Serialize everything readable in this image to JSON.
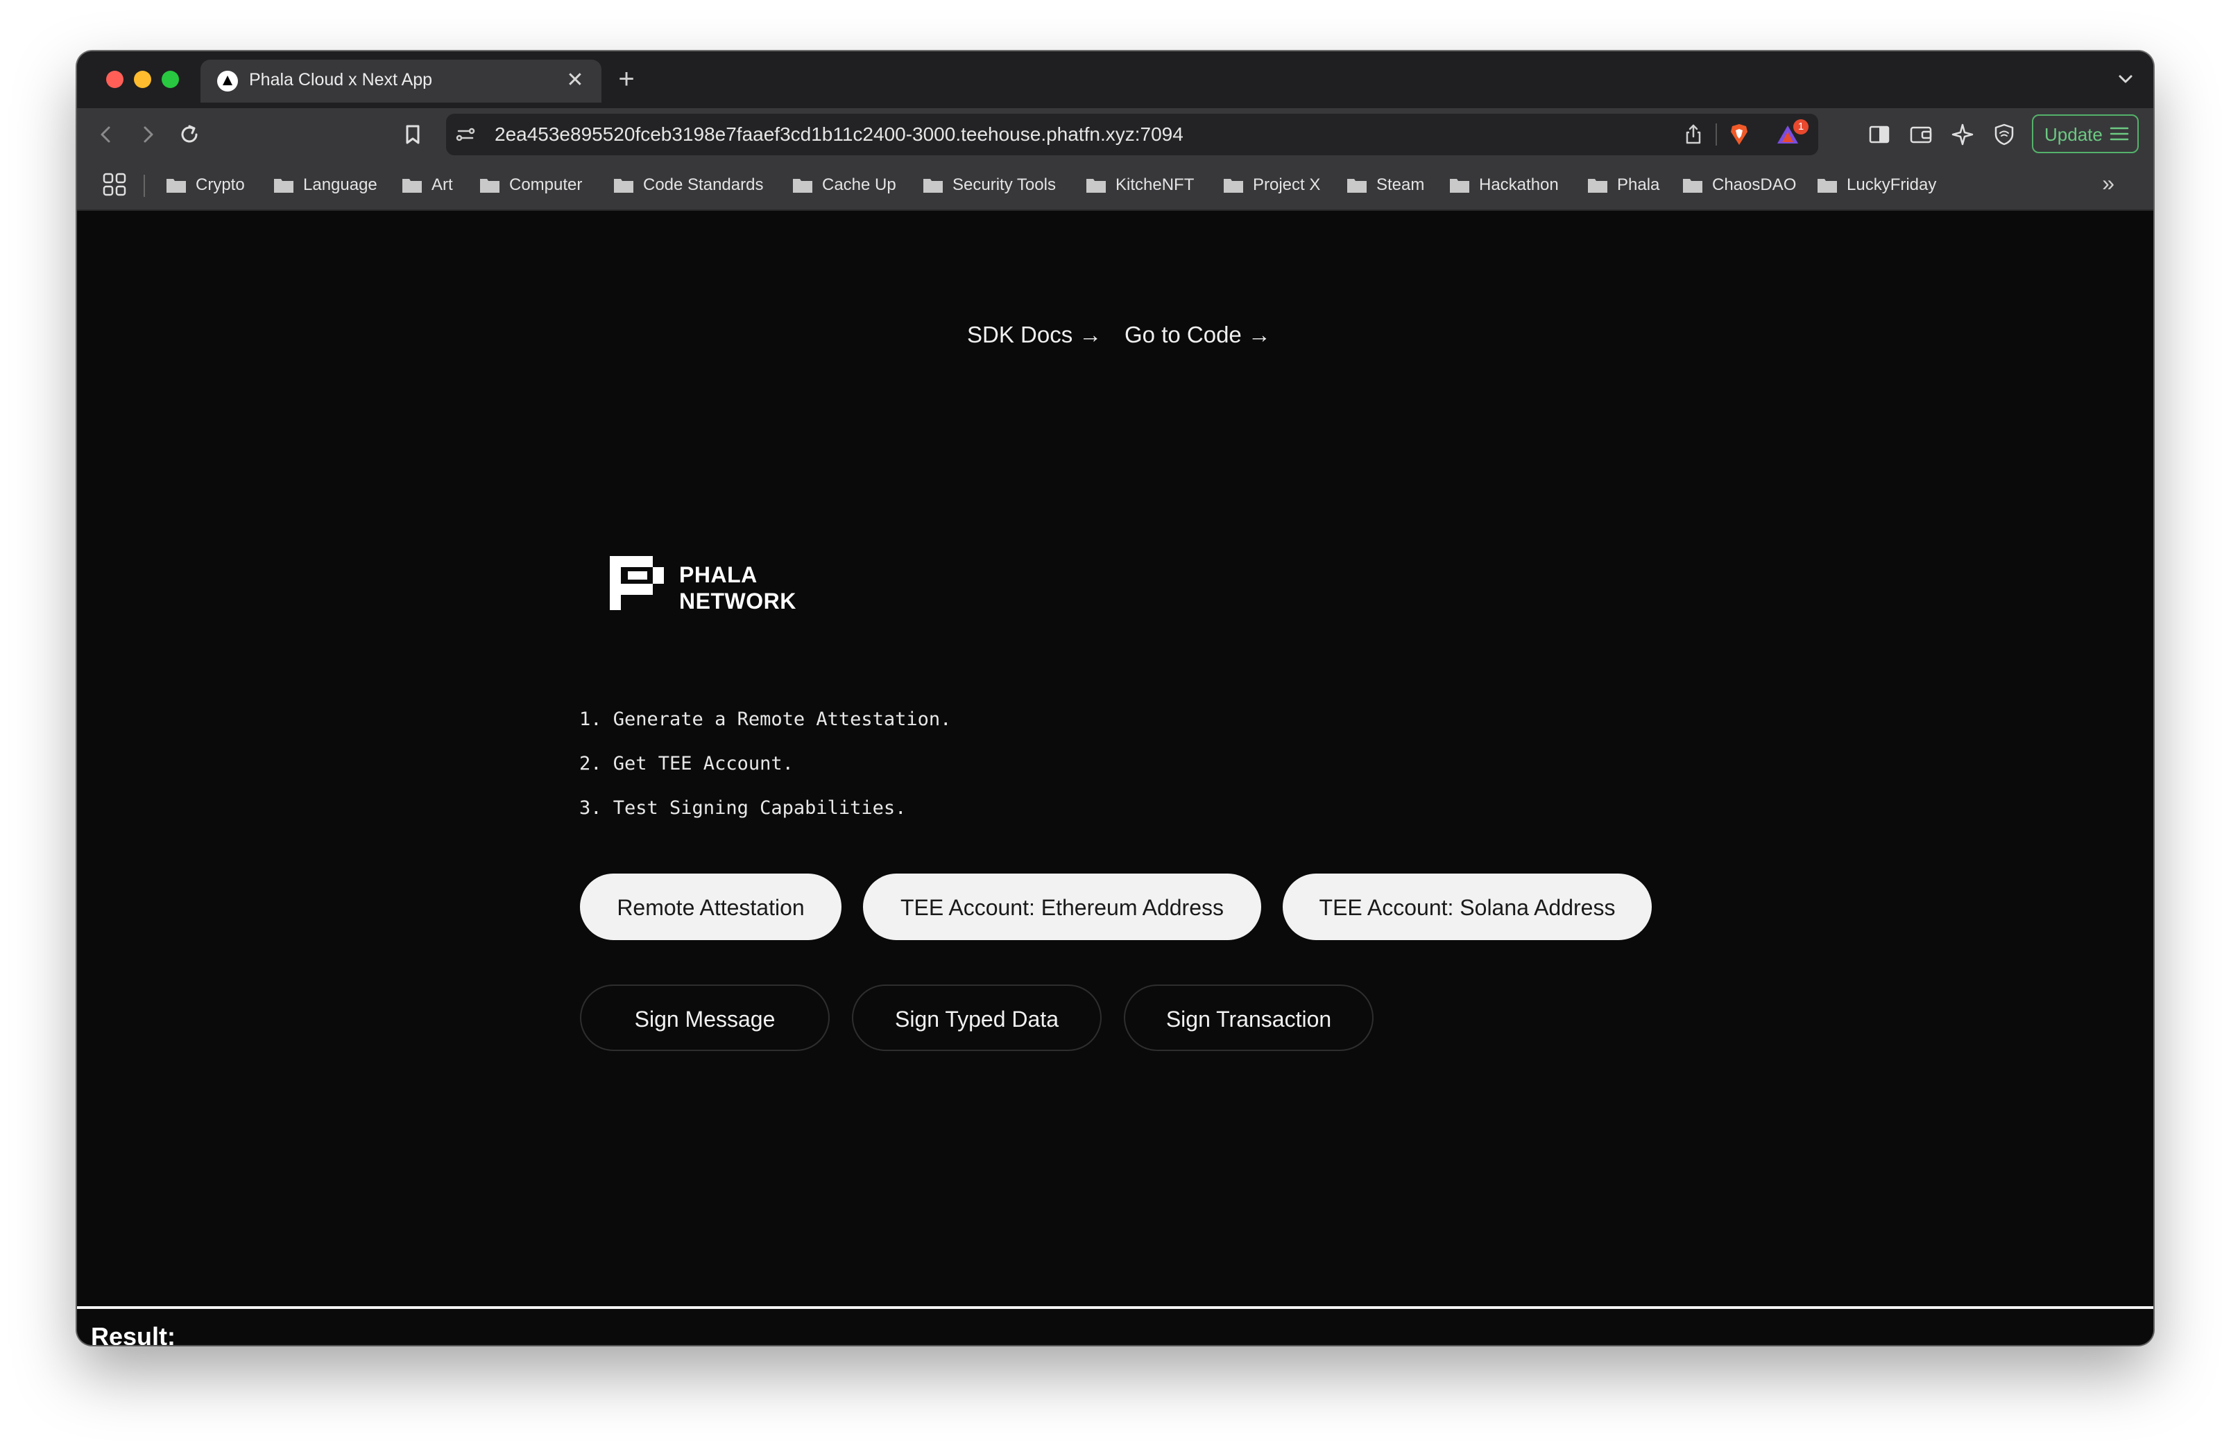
{
  "tab": {
    "title": "Phala Cloud x Next App",
    "favicon": "triangle-logo-icon",
    "close_glyph": "✕",
    "new_tab_glyph": "+"
  },
  "toolbar": {
    "url": "2ea453e895520fceb3198e7faaef3cd1b11c2400-3000.teehouse.phatfn.xyz:7094",
    "shield_badge_count": "1",
    "update_label": "Update",
    "accent_color": "#55b26a"
  },
  "bookmarks": {
    "items": [
      {
        "label": "Crypto"
      },
      {
        "label": "Language"
      },
      {
        "label": "Art"
      },
      {
        "label": "Computer"
      },
      {
        "label": "Code Standards"
      },
      {
        "label": "Cache Up"
      },
      {
        "label": "Security Tools"
      },
      {
        "label": "KitcheNFT"
      },
      {
        "label": "Project X"
      },
      {
        "label": "Steam"
      },
      {
        "label": "Hackathon"
      },
      {
        "label": "Phala"
      },
      {
        "label": "ChaosDAO"
      },
      {
        "label": "LuckyFriday"
      }
    ],
    "more_glyph": "»"
  },
  "page": {
    "links": [
      {
        "label": "SDK Docs →"
      },
      {
        "label": "Go to Code →"
      }
    ],
    "logo": {
      "line1": "PHALA",
      "line2": "NETWORK"
    },
    "steps": [
      "1. Generate a Remote Attestation.",
      "2. Get TEE Account.",
      "3. Test Signing Capabilities."
    ],
    "primary_buttons": [
      {
        "label": "Remote Attestation"
      },
      {
        "label": "TEE Account: Ethereum Address"
      },
      {
        "label": "TEE Account: Solana Address"
      }
    ],
    "secondary_buttons": [
      {
        "label": "Sign Message"
      },
      {
        "label": "Sign Typed Data"
      },
      {
        "label": "Sign Transaction"
      }
    ],
    "result_label": "Result:"
  }
}
